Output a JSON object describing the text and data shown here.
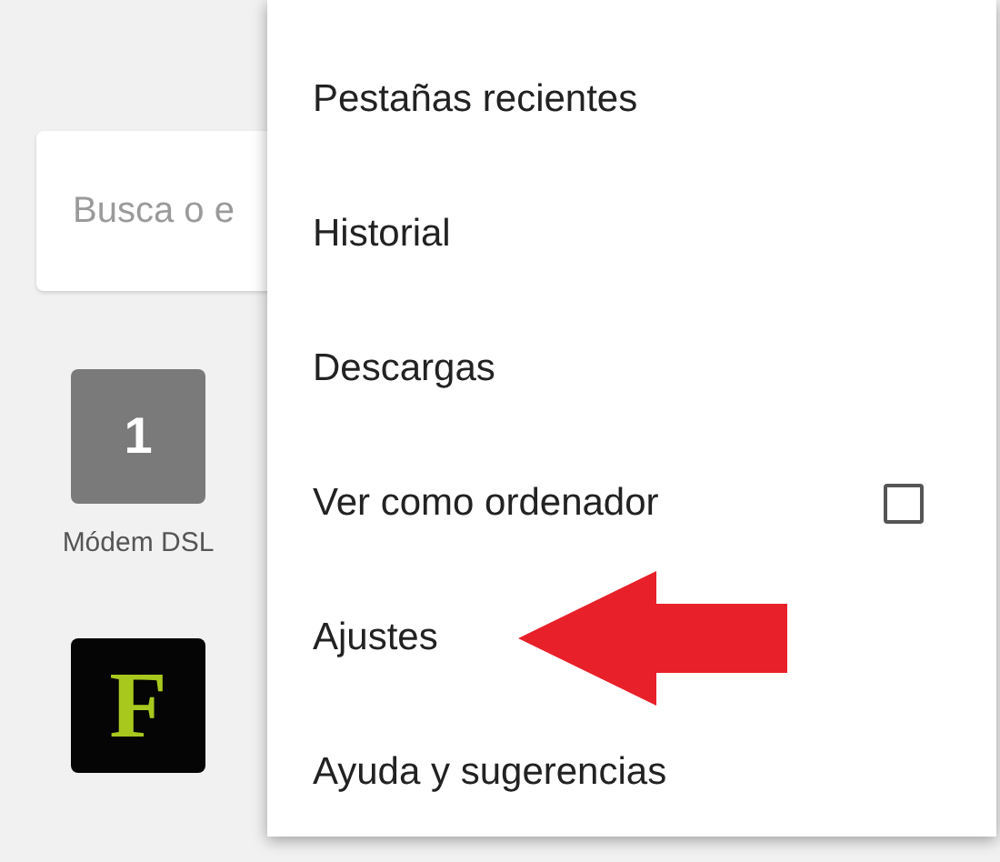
{
  "search": {
    "placeholder": "Busca o e"
  },
  "tiles": [
    {
      "kind": "number",
      "glyph": "1",
      "label": "Módem DSL"
    },
    {
      "kind": "logo",
      "glyph": "F"
    }
  ],
  "menu": {
    "items": [
      {
        "label": "Pestañas recientes",
        "kind": "plain"
      },
      {
        "label": "Historial",
        "kind": "plain"
      },
      {
        "label": "Descargas",
        "kind": "plain"
      },
      {
        "label": "Ver como ordenador",
        "kind": "checkbox",
        "checked": false
      },
      {
        "label": "Ajustes",
        "kind": "plain",
        "pointed": true
      },
      {
        "label": "Ayuda y sugerencias",
        "kind": "plain"
      }
    ]
  }
}
